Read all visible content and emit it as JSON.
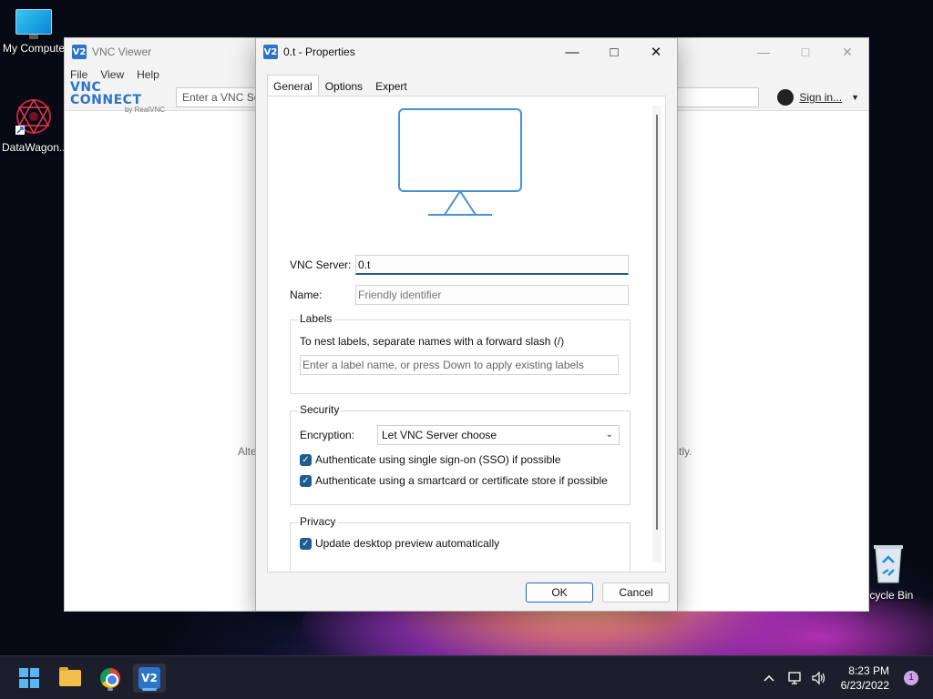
{
  "desktop": {
    "icons": [
      {
        "label": "My Compute"
      },
      {
        "label": "DataWagon..."
      },
      {
        "label": "ecycle Bin"
      }
    ]
  },
  "viewer": {
    "title": "VNC Viewer",
    "menu": [
      "File",
      "View",
      "Help"
    ],
    "brand": "VNC CONNECT",
    "brand_sub": "by RealVNC",
    "address_placeholder": "Enter a VNC Serv",
    "sign_in": "Sign in...",
    "hint_left": "Alte",
    "hint_right": "ctly."
  },
  "dialog": {
    "logo_text": "V2",
    "title": "0.t - Properties",
    "tabs": [
      "General",
      "Options",
      "Expert"
    ],
    "active_tab": "General",
    "vnc_server_label": "VNC Server:",
    "vnc_server_value": "0.t",
    "name_label": "Name:",
    "name_placeholder": "Friendly identifier",
    "labels": {
      "legend": "Labels",
      "help": "To nest labels, separate names with a forward slash (/)",
      "input_placeholder": "Enter a label name, or press Down to apply existing labels"
    },
    "security": {
      "legend": "Security",
      "encryption_label": "Encryption:",
      "encryption_value": "Let VNC Server choose",
      "sso": "Authenticate using single sign-on (SSO) if possible",
      "smartcard": "Authenticate using a smartcard or certificate store if possible",
      "sso_checked": true,
      "smartcard_checked": true
    },
    "privacy": {
      "legend": "Privacy",
      "preview": "Update desktop preview automatically",
      "preview_checked": true
    },
    "ok": "OK",
    "cancel": "Cancel"
  },
  "taskbar": {
    "time": "8:23 PM",
    "date": "6/23/2022",
    "notifications": "1"
  },
  "colors": {
    "accent": "#1f5d91",
    "vnc_blue": "#2b74c7",
    "monitor_stroke": "#4a90d9"
  }
}
